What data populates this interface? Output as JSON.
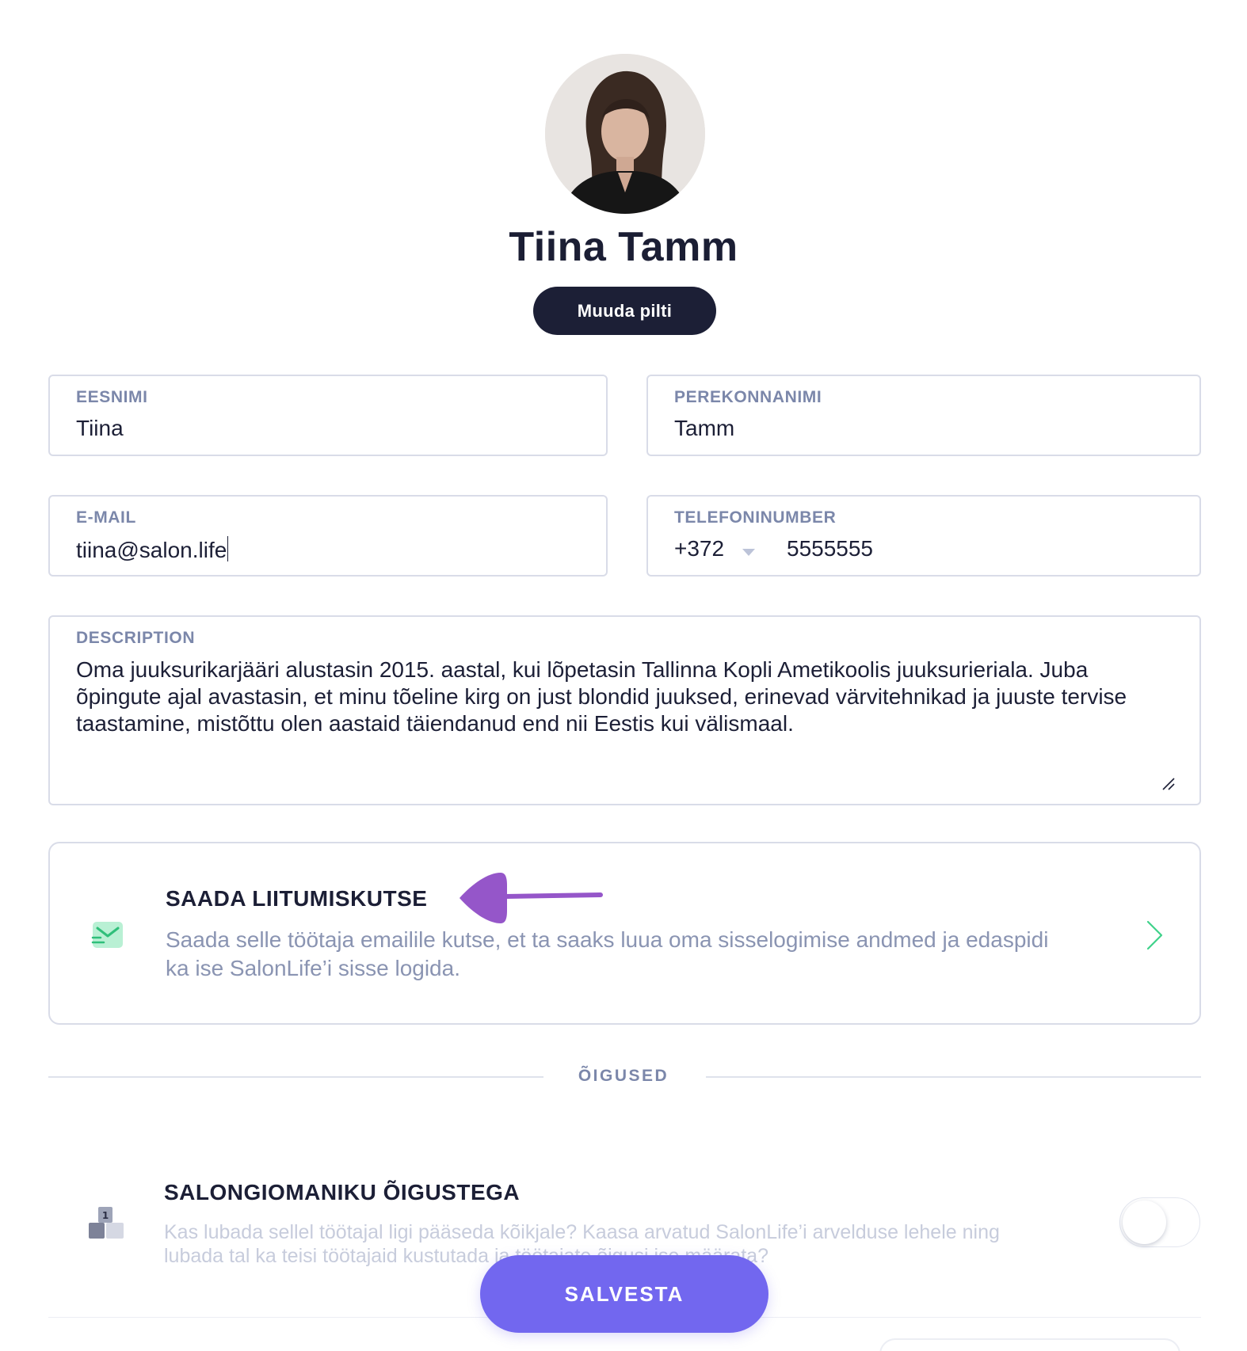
{
  "profile": {
    "name": "Tiina Tamm",
    "change_photo_label": "Muuda pilti"
  },
  "form": {
    "first_name": {
      "label": "EESNIMI",
      "value": "Tiina"
    },
    "last_name": {
      "label": "PEREKONNANIMI",
      "value": "Tamm"
    },
    "email": {
      "label": "E-MAIL",
      "value": "tiina@salon.life"
    },
    "phone": {
      "label": "TELEFONINUMBER",
      "country_code": "+372",
      "number": "5555555"
    },
    "description": {
      "label": "DESCRIPTION",
      "value": "Oma juuksurikarjääri alustasin 2015. aastal, kui lõpetasin Tallinna Kopli Ametikoolis juuksurieriala. Juba õpingute ajal avastasin, et minu tõeline kirg on just blondid juuksed, erinevad värvitehnikad ja juuste tervise taastamine, mistõttu olen aastaid täiendanud end nii Eestis kui välismaal."
    }
  },
  "invite": {
    "title": "SAADA LIITUMISKUTSE",
    "description": "Saada selle töötaja emailile kutse, et ta saaks luua oma sisselogimise andmed ja edaspidi ka ise SalonLife’i sisse logida.",
    "icon": "envelope-send-icon"
  },
  "permissions": {
    "section_label": "ÕIGUSED",
    "owner_rights": {
      "title": "SALONGIOMANIKU ÕIGUSTEGA",
      "description": "Kas lubada sellel töötajal ligi pääseda kõikjale? Kaasa arvatud SalonLife’i arvelduse lehele ning lubada tal ka teisi töötajaid kustutada ja töötajate õigusi ise määrata?",
      "enabled": false,
      "icon": "podium-rank-icon"
    }
  },
  "actions": {
    "save_label": "SALVESTA"
  },
  "colors": {
    "primary_dark": "#1c1f36",
    "accent_purple": "#7267ef",
    "annotation_purple": "#9556c9",
    "invite_green": "#3fd28a",
    "label_gray": "#7b87aa"
  }
}
